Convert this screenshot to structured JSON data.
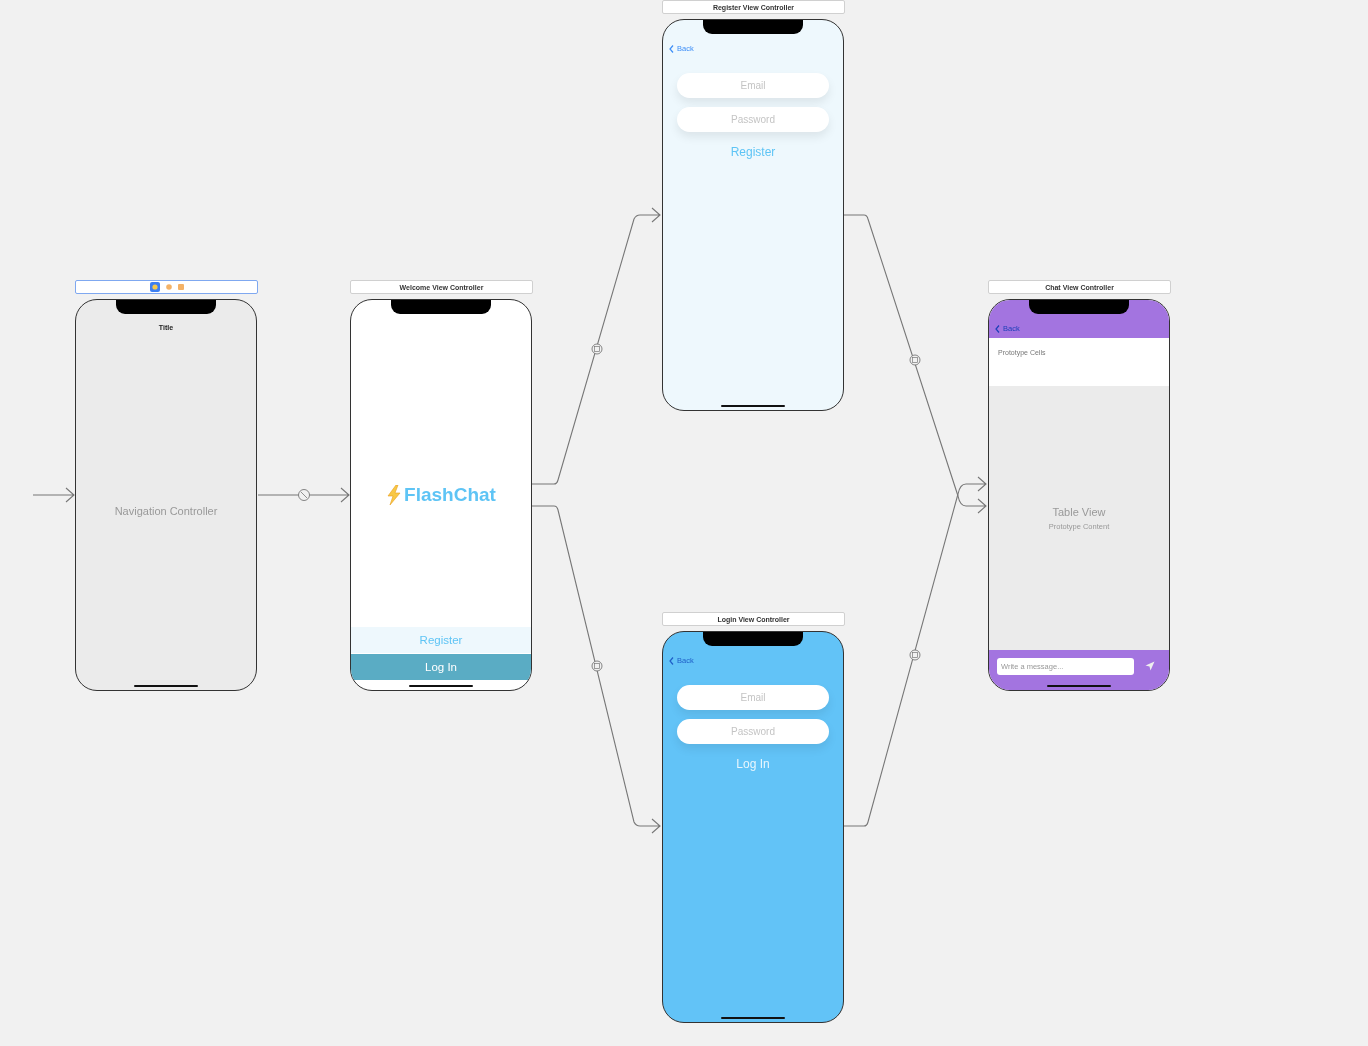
{
  "scenes": [
    {
      "kind": "navigation",
      "selected": true,
      "nav_title": "Title",
      "label": "Navigation Controller"
    },
    {
      "kind": "welcome",
      "selected": false,
      "title": "Welcome View Controller",
      "logo": "FlashChat",
      "buttons": [
        {
          "label": "Register",
          "kind": "light"
        },
        {
          "label": "Log In",
          "kind": "dark"
        }
      ]
    },
    {
      "kind": "register_form",
      "selected": false,
      "title": "Register View Controller",
      "back": "Back",
      "fields": [
        {
          "placeholder": "Email"
        },
        {
          "placeholder": "Password"
        }
      ],
      "action": "Register"
    },
    {
      "kind": "login_form",
      "selected": false,
      "title": "Login View Controller",
      "back": "Back",
      "fields": [
        {
          "placeholder": "Email"
        },
        {
          "placeholder": "Password"
        }
      ],
      "action": "Log In"
    },
    {
      "kind": "chat",
      "selected": false,
      "title": "Chat View Controller",
      "back": "Back",
      "section": "Prototype Cells",
      "table_title": "Table View",
      "table_subtitle": "Prototype Content",
      "message": {
        "placeholder": "Write a message..."
      }
    }
  ]
}
